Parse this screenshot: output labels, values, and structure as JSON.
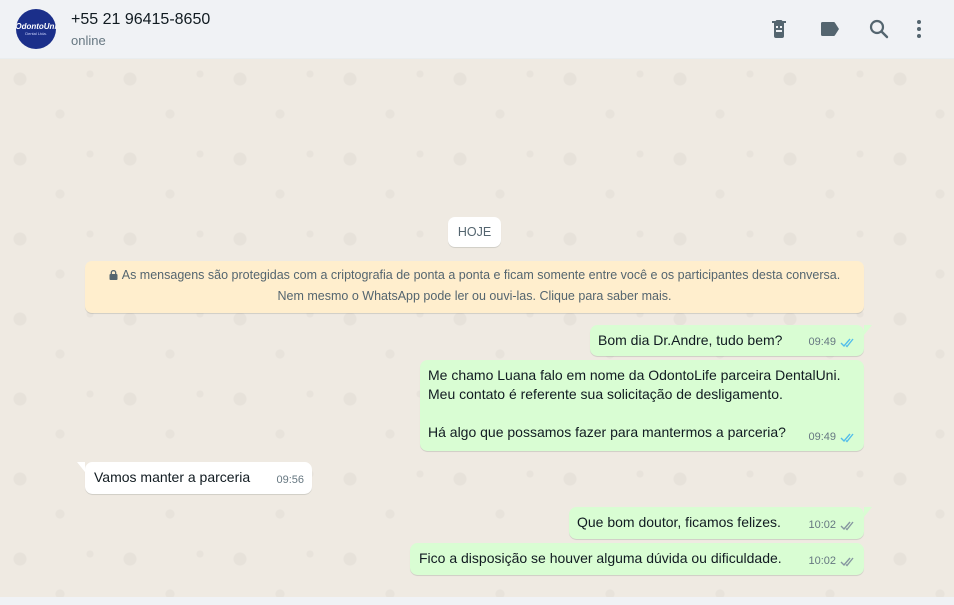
{
  "header": {
    "avatar": {
      "brand": "OdontoUni",
      "subtitle": "Dental Ltda."
    },
    "name": "+55 21 96415-8650",
    "status": "online",
    "icons": [
      "delete-chat-icon",
      "label-icon",
      "search-icon",
      "menu-icon"
    ]
  },
  "chat": {
    "date_chip": "HOJE",
    "encryption_notice": "As mensagens são protegidas com a criptografia de ponta a ponta e ficam somente entre você e os participantes desta conversa. Nem mesmo o WhatsApp pode ler ou ouvi-las. Clique para saber mais.",
    "messages": [
      {
        "direction": "out",
        "text": "Bom dia Dr.Andre, tudo bem?",
        "time": "09:49",
        "status": "read"
      },
      {
        "direction": "out",
        "text": "Me chamo Luana falo em nome da OdontoLife parceira DentalUni.\nMeu contato é referente sua solicitação de desligamento.\n\nHá algo que possamos fazer para mantermos a parceria?",
        "time": "09:49",
        "status": "read"
      },
      {
        "direction": "in",
        "text": "Vamos manter a parceria",
        "time": "09:56"
      },
      {
        "direction": "out",
        "text": "Que bom doutor, ficamos felizes.",
        "time": "10:02",
        "status": "delivered"
      },
      {
        "direction": "out",
        "text": "Fico a disposição se houver alguma dúvida ou dificuldade.",
        "time": "10:02",
        "status": "delivered"
      }
    ]
  },
  "colors": {
    "read_tick": "#53bdeb",
    "delivered_tick": "#8696a0",
    "outgoing_bubble": "#d9fdd3",
    "incoming_bubble": "#ffffff",
    "notice_bg": "#ffeecd"
  }
}
